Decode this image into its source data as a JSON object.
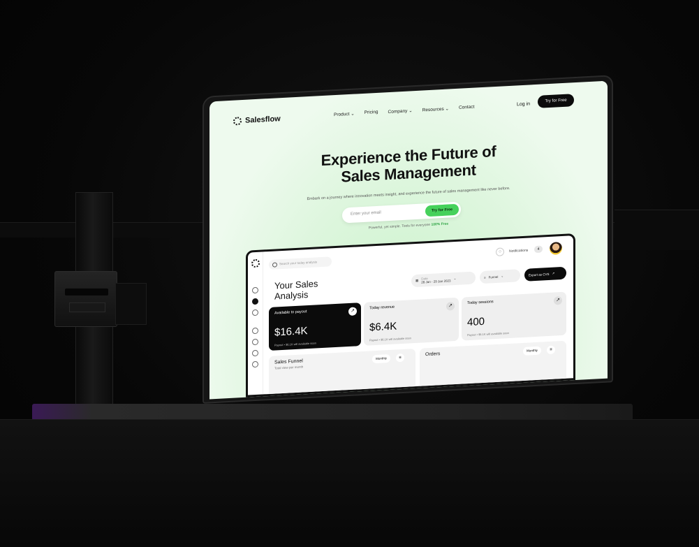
{
  "site": {
    "brand": "Salesflow",
    "nav": [
      "Product",
      "Pricing",
      "Company",
      "Resources",
      "Contact"
    ],
    "login": "Log in",
    "cta": "Try for Free"
  },
  "hero": {
    "title_line1": "Experience the Future of",
    "title_line2": "Sales Management",
    "subtitle": "Embark on a journey where innovation meets insight, and experience the future of sales management like never before.",
    "email_placeholder": "Enter your email",
    "submit": "Try for Free",
    "powered_prefix": "Powerful, yet simple. Tools for everyone",
    "powered_highlight": "100% Free"
  },
  "dashboard": {
    "search_placeholder": "Search your today analysis",
    "notifications_label": "Notifications",
    "notifications_count": "4",
    "title_line1": "Your Sales",
    "title_line2": "Analysis",
    "date_label": "Date",
    "date_range": "28 Jan - 29 Jan 2023",
    "funnel": "Funnel",
    "export": "Export as CVS",
    "cards": [
      {
        "label": "Available to payout",
        "value": "$16.4K",
        "foot": "Payout • $6.1K will available soon"
      },
      {
        "label": "Today revenue",
        "value": "$6.4K",
        "foot": "Payout • $6.1K will available soon"
      },
      {
        "label": "Today sessions",
        "value": "400",
        "foot": "Payout • $6.1K will available soon"
      }
    ],
    "sales_funnel": {
      "title": "Sales Funnel",
      "subtitle": "Total view per month",
      "period": "Monthly"
    },
    "orders": {
      "title": "Orders",
      "period": "Monthly"
    }
  },
  "colors": {
    "accent": "#46d15b",
    "background": "#050505"
  },
  "icons": [
    "logo-icon",
    "chevron-down-icon",
    "search-icon",
    "bell-icon",
    "arrow-up-right-icon",
    "filter-icon",
    "calendar-icon"
  ]
}
